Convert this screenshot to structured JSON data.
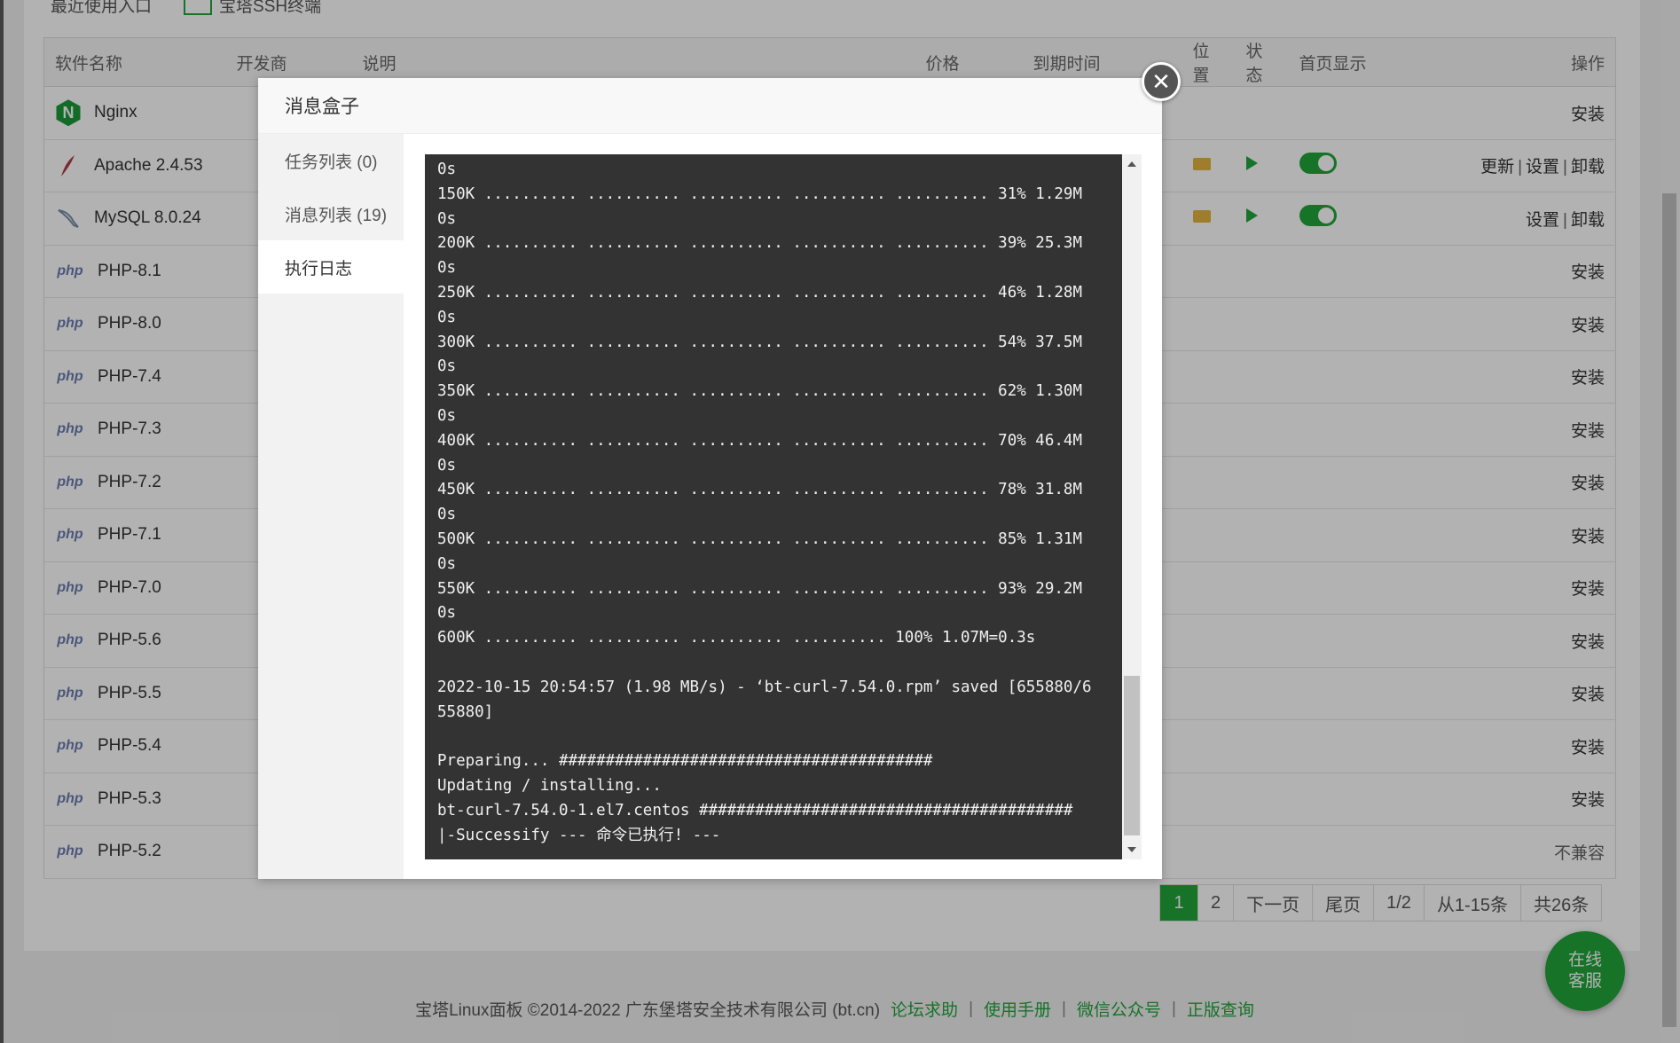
{
  "top_tabs": {
    "recent": "最近使用入口",
    "ssh": "宝塔SSH终端"
  },
  "table": {
    "headers": [
      "软件名称",
      "开发商",
      "说明",
      "价格",
      "到期时间",
      "位置",
      "状态",
      "首页显示",
      "操作"
    ],
    "rows": [
      {
        "name": "Nginx",
        "icon": "nginx-icon",
        "op": "安装"
      },
      {
        "name": "Apache 2.4.53",
        "icon": "apache-feather-icon",
        "op_update": "更新",
        "op_settings": "设置",
        "op_uninstall": "卸载"
      },
      {
        "name": "MySQL 8.0.24",
        "icon": "mysql-dolphin-icon",
        "op_settings": "设置",
        "op_uninstall": "卸载"
      },
      {
        "name": "PHP-8.1",
        "op": "安装"
      },
      {
        "name": "PHP-8.0",
        "op": "安装"
      },
      {
        "name": "PHP-7.4",
        "op": "安装"
      },
      {
        "name": "PHP-7.3",
        "op": "安装"
      },
      {
        "name": "PHP-7.2",
        "op": "安装"
      },
      {
        "name": "PHP-7.1",
        "op": "安装"
      },
      {
        "name": "PHP-7.0",
        "op": "安装"
      },
      {
        "name": "PHP-5.6",
        "op": "安装"
      },
      {
        "name": "PHP-5.5",
        "op": "安装"
      },
      {
        "name": "PHP-5.4",
        "op": "安装"
      },
      {
        "name": "PHP-5.3",
        "op": "安装"
      },
      {
        "name": "PHP-5.2",
        "op": "不兼容"
      }
    ],
    "php_label": "php"
  },
  "pager": {
    "p1": "1",
    "p2": "2",
    "next": "下一页",
    "last": "尾页",
    "pages": "1/2",
    "range": "从1-15条",
    "total": "共26条"
  },
  "footer": {
    "copyright": "宝塔Linux面板 ©2014-2022 广东堡塔安全技术有限公司 (bt.cn)",
    "links": [
      "论坛求助",
      "使用手册",
      "微信公众号",
      "正版查询"
    ],
    "sep": "|"
  },
  "chat": {
    "line1": "在线",
    "line2": "客服"
  },
  "modal": {
    "title": "消息盒子",
    "tabs": [
      "任务列表 (0)",
      "消息列表 (19)",
      "执行日志"
    ],
    "active_tab": 2,
    "close_glyph": "✕",
    "log": "0s\n150K .......... .......... .......... .......... .......... 31% 1.29M\n0s\n200K .......... .......... .......... .......... .......... 39% 25.3M\n0s\n250K .......... .......... .......... .......... .......... 46% 1.28M\n0s\n300K .......... .......... .......... .......... .......... 54% 37.5M\n0s\n350K .......... .......... .......... .......... .......... 62% 1.30M\n0s\n400K .......... .......... .......... .......... .......... 70% 46.4M\n0s\n450K .......... .......... .......... .......... .......... 78% 31.8M\n0s\n500K .......... .......... .......... .......... .......... 85% 1.31M\n0s\n550K .......... .......... .......... .......... .......... 93% 29.2M\n0s\n600K .......... .......... .......... .......... 100% 1.07M=0.3s\n\n2022-10-15 20:54:57 (1.98 MB/s) - ‘bt-curl-7.54.0.rpm’ saved [655880/6\n55880]\n\nPreparing... ########################################\nUpdating / installing...\nbt-curl-7.54.0-1.el7.centos ########################################\n|-Successify --- 命令已执行! ---"
  },
  "colors": {
    "accent": "#20a53a",
    "terminal_bg": "#333333"
  }
}
